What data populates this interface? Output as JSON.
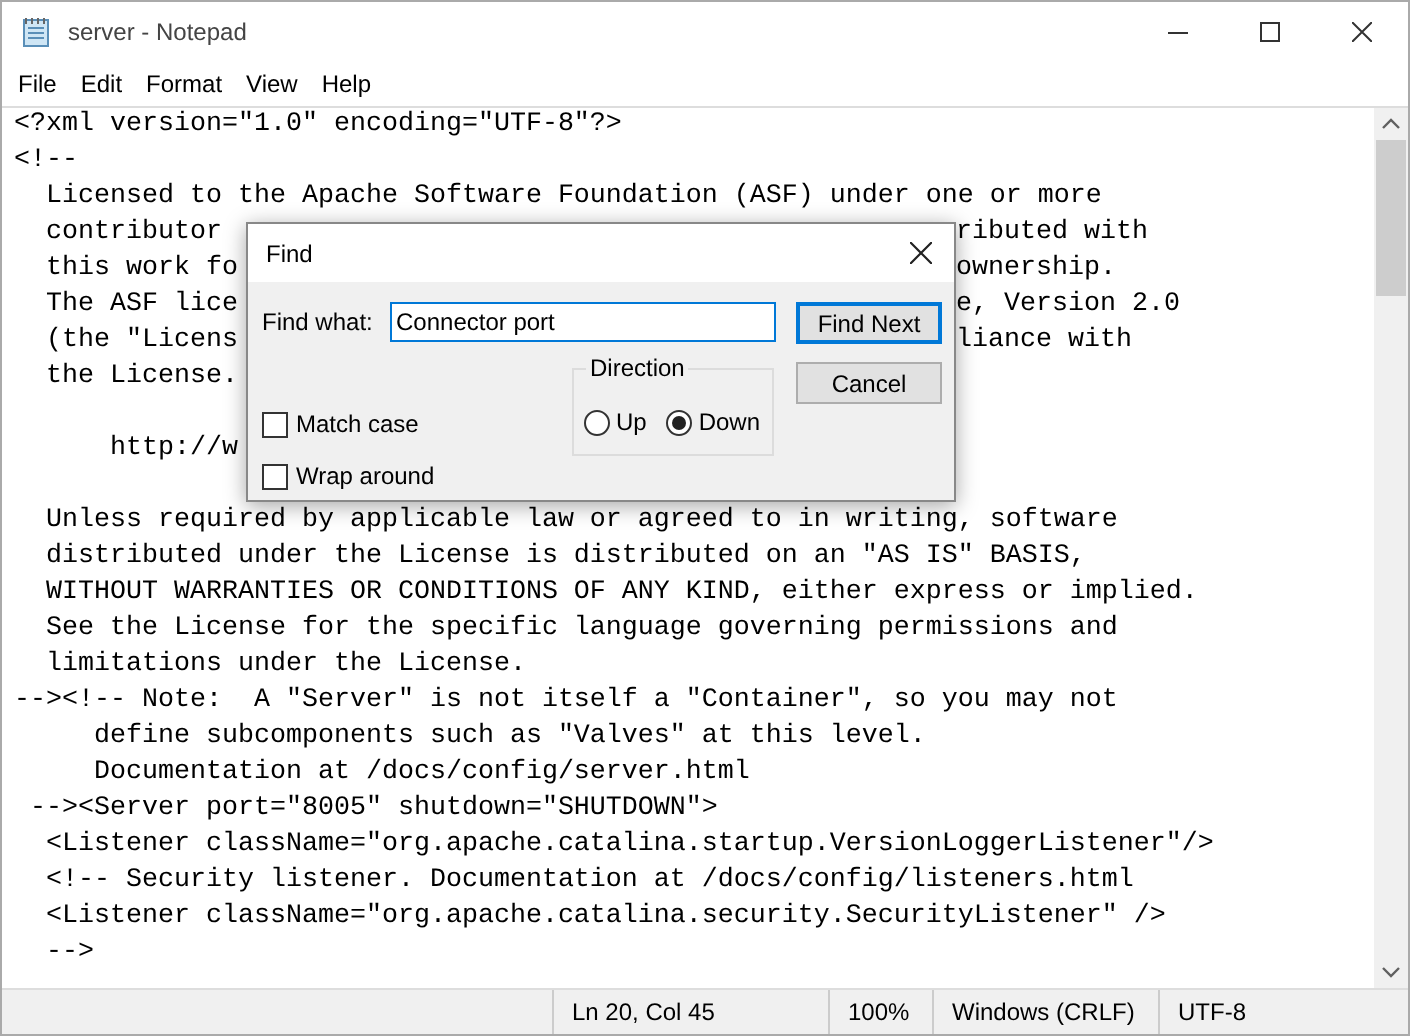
{
  "window": {
    "title": "server - Notepad"
  },
  "menu": [
    {
      "label": "File"
    },
    {
      "label": "Edit"
    },
    {
      "label": "Format"
    },
    {
      "label": "View"
    },
    {
      "label": "Help"
    }
  ],
  "editor": {
    "lines": [
      {
        "kind": "code",
        "text": "<?xml version=\"1.0\" encoding=\"UTF-8\"?>"
      },
      {
        "kind": "code",
        "text": "<!--"
      },
      {
        "kind": "code",
        "text": "  Licensed to the Apache Software Foundation (ASF) under one or more"
      },
      {
        "kind": "code",
        "text": "  contributor",
        "right": "ributed with"
      },
      {
        "kind": "code",
        "text": "  this work fo",
        "right": "ownership."
      },
      {
        "kind": "code",
        "text": "  The ASF lice",
        "right": "e, Version 2.0"
      },
      {
        "kind": "code",
        "text": "  (the \"Licens",
        "right": "liance with"
      },
      {
        "kind": "code",
        "text": "  the License."
      },
      {
        "kind": "blank"
      },
      {
        "kind": "code",
        "text": "      http://w"
      },
      {
        "kind": "blank"
      },
      {
        "kind": "code",
        "text": "  Unless required by applicable law or agreed to in writing, software"
      },
      {
        "kind": "code",
        "text": "  distributed under the License is distributed on an \"AS IS\" BASIS,"
      },
      {
        "kind": "code",
        "text": "  WITHOUT WARRANTIES OR CONDITIONS OF ANY KIND, either express or implied."
      },
      {
        "kind": "code",
        "text": "  See the License for the specific language governing permissions and"
      },
      {
        "kind": "code",
        "text": "  limitations under the License."
      },
      {
        "kind": "code",
        "text": "--><!-- Note:  A \"Server\" is not itself a \"Container\", so you may not"
      },
      {
        "kind": "code",
        "text": "     define subcomponents such as \"Valves\" at this level."
      },
      {
        "kind": "code",
        "text": "     Documentation at /docs/config/server.html"
      },
      {
        "kind": "code",
        "text": " --><Server port=\"8005\" shutdown=\"SHUTDOWN\">"
      },
      {
        "kind": "code",
        "text": "  <Listener className=\"org.apache.catalina.startup.VersionLoggerListener\"/>"
      },
      {
        "kind": "code",
        "text": "  <!-- Security listener. Documentation at /docs/config/listeners.html"
      },
      {
        "kind": "code",
        "text": "  <Listener className=\"org.apache.catalina.security.SecurityListener\" />"
      },
      {
        "kind": "code",
        "text": "  -->"
      }
    ]
  },
  "find_dialog": {
    "title": "Find",
    "find_what_label": "Find what:",
    "find_what_value": "Connector port",
    "find_next": "Find Next",
    "cancel": "Cancel",
    "direction_label": "Direction",
    "directions": [
      {
        "label": "Up",
        "selected": false
      },
      {
        "label": "Down",
        "selected": true
      }
    ],
    "options": [
      {
        "label": "Match case",
        "checked": false
      },
      {
        "label": "Wrap around",
        "checked": false
      }
    ]
  },
  "status_bar": [
    "Ln 20, Col 45",
    "100%",
    "Windows (CRLF)",
    "UTF-8"
  ]
}
